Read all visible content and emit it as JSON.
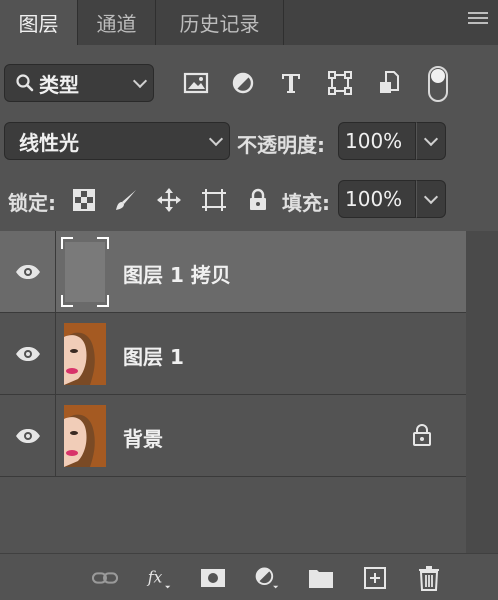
{
  "tabs": [
    {
      "label": "图层",
      "active": true
    },
    {
      "label": "通道",
      "active": false
    },
    {
      "label": "历史记录",
      "active": false
    }
  ],
  "filter": {
    "kind_label": "类型",
    "icons": [
      "image-filter-icon",
      "adjustment-filter-icon",
      "type-filter-icon",
      "shape-filter-icon",
      "smart-object-filter-icon",
      "filter-toggle-switch"
    ]
  },
  "blend": {
    "mode": "线性光",
    "opacity_label": "不透明度:",
    "opacity_value": "100%"
  },
  "lock": {
    "label": "锁定:",
    "fill_label": "填充:",
    "fill_value": "100%"
  },
  "layers": [
    {
      "name": "图层 1 拷贝",
      "selected": true,
      "locked": false,
      "thumb": "gray"
    },
    {
      "name": "图层 1",
      "selected": false,
      "locked": false,
      "thumb": "portrait"
    },
    {
      "name": "背景",
      "selected": false,
      "locked": true,
      "thumb": "portrait"
    }
  ],
  "colors": {
    "panel_bg": "#535353",
    "selected_row": "#6a6a6a",
    "field_bg": "#3c3c3c"
  }
}
